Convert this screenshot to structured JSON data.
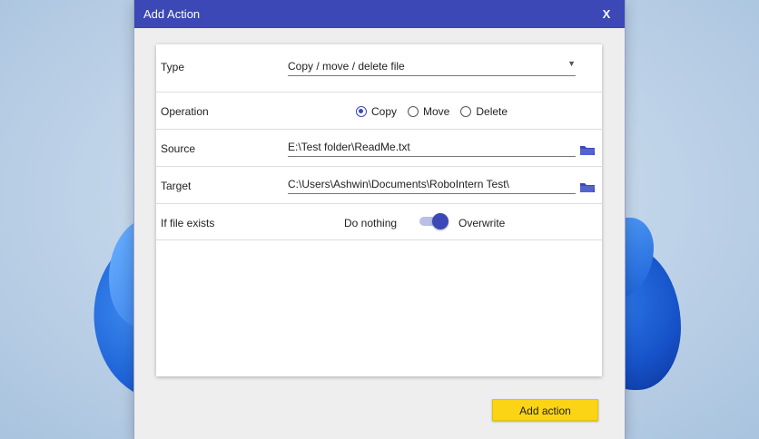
{
  "dialog": {
    "title": "Add Action",
    "close_label": "X"
  },
  "form": {
    "type": {
      "label": "Type",
      "value": "Copy / move / delete file"
    },
    "operation": {
      "label": "Operation",
      "options": [
        {
          "label": "Copy",
          "checked": true
        },
        {
          "label": "Move",
          "checked": false
        },
        {
          "label": "Delete",
          "checked": false
        }
      ]
    },
    "source": {
      "label": "Source",
      "value": "E:\\Test folder\\ReadMe.txt"
    },
    "target": {
      "label": "Target",
      "value": "C:\\Users\\Ashwin\\Documents\\RoboIntern Test\\"
    },
    "if_exists": {
      "label": "If file exists",
      "off_label": "Do nothing",
      "on_label": "Overwrite",
      "toggle_on": true
    }
  },
  "footer": {
    "add_label": "Add action"
  },
  "colors": {
    "accent": "#3b48b5",
    "button": "#fbd416"
  }
}
